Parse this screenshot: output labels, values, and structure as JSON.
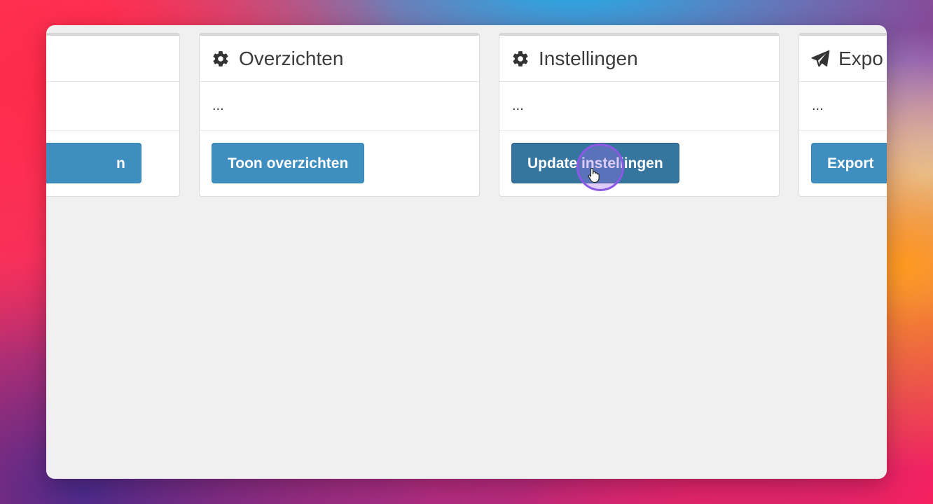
{
  "cards": [
    {
      "title": "",
      "body": "",
      "button": "n"
    },
    {
      "icon": "gear-icon",
      "title": "Overzichten",
      "body": "...",
      "button": "Toon overzichten"
    },
    {
      "icon": "gear-icon",
      "title": "Instellingen",
      "body": "...",
      "button": "Update instellingen"
    },
    {
      "icon": "paper-plane-icon",
      "title": "Expo",
      "body": "...",
      "button": "Export"
    }
  ],
  "colors": {
    "button": "#3f8ec0",
    "button_hover": "#35759e",
    "window_bg": "#f0f0f0",
    "cursor_ring": "#8d57e6"
  }
}
